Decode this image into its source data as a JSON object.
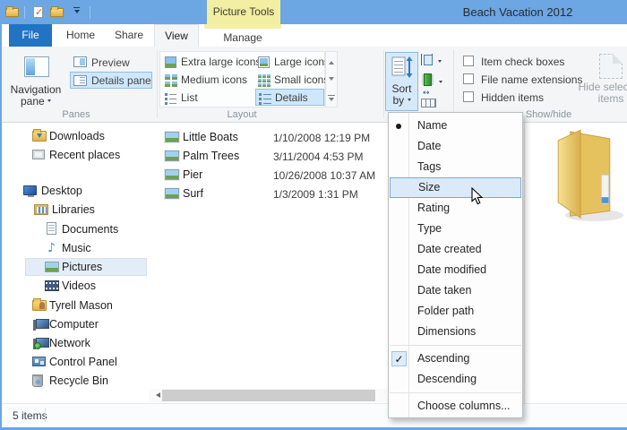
{
  "titlebar": {
    "title": "Beach Vacation 2012",
    "contextual_group_label": "Picture Tools",
    "qat_icons": [
      "explorer-folder-icon",
      "properties-check-icon",
      "new-folder-icon",
      "customize-quick-access-dropdown"
    ]
  },
  "tabs": {
    "file_label": "File",
    "home_label": "Home",
    "share_label": "Share",
    "view_label": "View",
    "manage_label": "Manage",
    "active_tab": "View"
  },
  "ribbon": {
    "panes": {
      "group_label": "Panes",
      "navigation_pane_label": "Navigation pane",
      "preview_pane_label": "Preview pane",
      "details_pane_label": "Details pane",
      "details_pane_selected": true
    },
    "layout": {
      "group_label": "Layout",
      "extra_large_label": "Extra large icons",
      "large_label": "Large icons",
      "medium_label": "Medium icons",
      "small_label": "Small icons",
      "list_label": "List",
      "details_label": "Details",
      "selected": "Details"
    },
    "current_view": {
      "sort_by_label": "Sort by",
      "sort_by_pressed": true
    },
    "show_hide": {
      "group_label": "Show/hide",
      "item_check_boxes_label": "Item check boxes",
      "file_name_extensions_label": "File name extensions",
      "hidden_items_label": "Hidden items",
      "checkbox_states": [
        false,
        false,
        false
      ],
      "hide_selected_label": "Hide selected items",
      "hide_selected_enabled": false
    }
  },
  "sidebar": {
    "items": [
      {
        "label": "Downloads",
        "icon": "downloads-folder",
        "selected": false
      },
      {
        "label": "Recent places",
        "icon": "recent-places",
        "selected": false
      },
      {
        "label": "Desktop",
        "icon": "desktop-monitor",
        "selected": false
      },
      {
        "label": "Libraries",
        "icon": "libraries",
        "selected": false
      },
      {
        "label": "Documents",
        "icon": "document",
        "selected": false
      },
      {
        "label": "Music",
        "icon": "music-note",
        "selected": false
      },
      {
        "label": "Pictures",
        "icon": "picture",
        "selected": true
      },
      {
        "label": "Videos",
        "icon": "video-film",
        "selected": false
      },
      {
        "label": "Tyrell Mason",
        "icon": "user-folder",
        "selected": false
      },
      {
        "label": "Computer",
        "icon": "computer",
        "selected": false
      },
      {
        "label": "Network",
        "icon": "network-globe",
        "selected": false
      },
      {
        "label": "Control Panel",
        "icon": "control-panel",
        "selected": false
      },
      {
        "label": "Recycle Bin",
        "icon": "recycle-bin",
        "selected": false
      }
    ]
  },
  "file_list": {
    "rows": [
      {
        "name": "Little Boats",
        "date_modified": "1/10/2008 12:19 PM"
      },
      {
        "name": "Palm Trees",
        "date_modified": "3/11/2004 4:53 PM"
      },
      {
        "name": "Pier",
        "date_modified": "10/26/2008 10:37 AM"
      },
      {
        "name": "Surf",
        "date_modified": "1/3/2009 1:31 PM"
      }
    ]
  },
  "sort_menu": {
    "fields": [
      "Name",
      "Date",
      "Tags",
      "Size",
      "Rating",
      "Type",
      "Date created",
      "Date modified",
      "Date taken",
      "Folder path",
      "Dimensions"
    ],
    "selected_field": "Name",
    "highlighted_item": "Size",
    "order_options": [
      "Ascending",
      "Descending"
    ],
    "checked_order": "Ascending",
    "choose_columns_label": "Choose columns..."
  },
  "status_bar": {
    "item_count": "5 items"
  },
  "icons": {
    "music_note": "♪",
    "checkmark": "✓",
    "resize_columns_glyph": "↔"
  },
  "colors": {
    "titlebar_blue": "#6CA6E3",
    "file_tab_blue": "#2173C4",
    "contextual_tab_yellow": "#F2EEA2",
    "ribbon_background": "#F3F5F6",
    "selected_button_bg": "#CFE7FA",
    "selected_button_border": "#94BEE2",
    "menu_highlight_bg": "#DBEAF9",
    "menu_highlight_border": "#7EA8D2",
    "sidebar_selection_bg": "#E3EDF8"
  }
}
